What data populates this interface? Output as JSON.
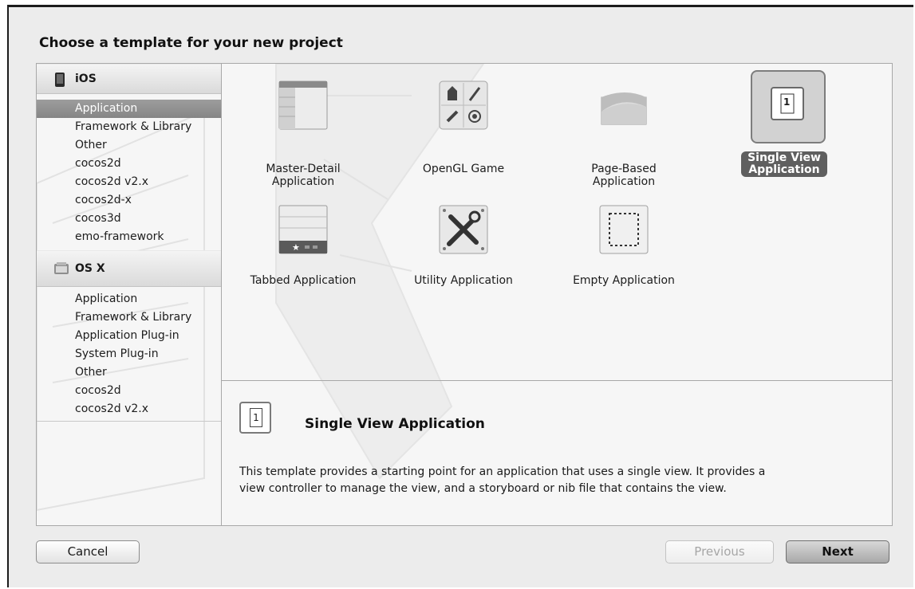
{
  "dialog": {
    "title": "Choose a template for your new project"
  },
  "sidebar": {
    "groups": [
      {
        "label": "iOS",
        "icon": "iphone-icon",
        "items": [
          "Application",
          "Framework & Library",
          "Other",
          "cocos2d",
          "cocos2d v2.x",
          "cocos2d-x",
          "cocos3d",
          "emo-framework"
        ],
        "selected": "Application"
      },
      {
        "label": "OS X",
        "icon": "finder-icon",
        "items": [
          "Application",
          "Framework & Library",
          "Application Plug-in",
          "System Plug-in",
          "Other",
          "cocos2d",
          "cocos2d v2.x"
        ]
      }
    ]
  },
  "templates": [
    {
      "label1": "Master-Detail",
      "label2": "Application",
      "icon": "master-detail-icon"
    },
    {
      "label1": "OpenGL Game",
      "label2": "",
      "icon": "opengl-game-icon"
    },
    {
      "label1": "Page-Based",
      "label2": "Application",
      "icon": "page-based-icon"
    },
    {
      "label1": "Single View",
      "label2": "Application",
      "icon": "single-view-icon",
      "selected": true
    },
    {
      "label1": "Tabbed Application",
      "label2": "",
      "icon": "tabbed-icon"
    },
    {
      "label1": "Utility Application",
      "label2": "",
      "icon": "utility-icon"
    },
    {
      "label1": "Empty Application",
      "label2": "",
      "icon": "empty-application-icon"
    }
  ],
  "description": {
    "icon_number": "1",
    "title": "Single View Application",
    "line1": "This template provides a starting point for an application that uses a single view. It provides a",
    "line2": "view controller to manage the view, and a storyboard or nib file that contains the view."
  },
  "buttons": {
    "cancel": "Cancel",
    "previous": "Previous",
    "next": "Next"
  },
  "single_view_icon_number": "1",
  "colors": {
    "selection": "#8f8f8f",
    "selected_label_bg": "#5f5f5f"
  }
}
